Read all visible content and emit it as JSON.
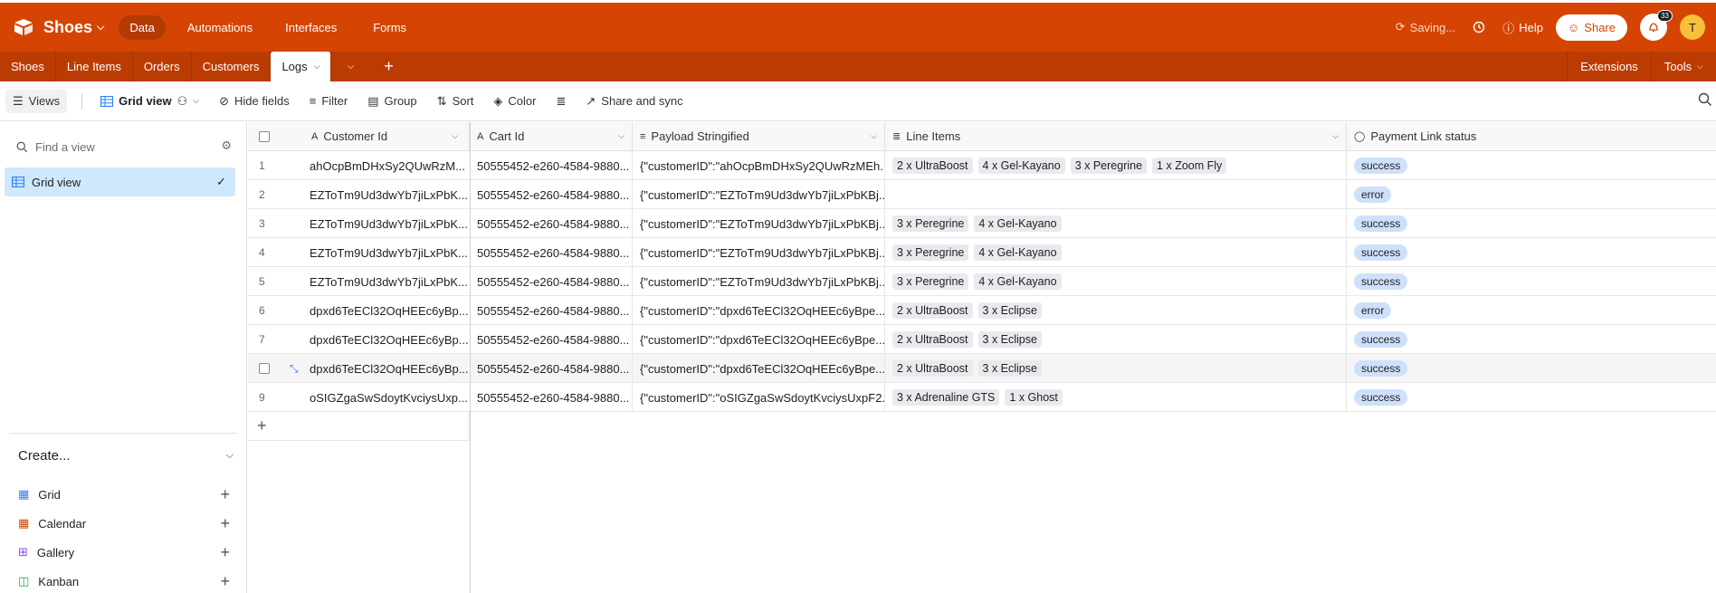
{
  "app": {
    "base_name": "Shoes",
    "nav": [
      "Data",
      "Automations",
      "Interfaces",
      "Forms"
    ],
    "saving_text": "Saving...",
    "help_label": "Help",
    "share_label": "Share",
    "notif_count": "33",
    "avatar_initial": "T",
    "brand_color": "#d54402"
  },
  "tabs": {
    "items": [
      "Shoes",
      "Line Items",
      "Orders",
      "Customers"
    ],
    "active": "Logs",
    "extensions_label": "Extensions",
    "tools_label": "Tools"
  },
  "toolbar": {
    "views": "Views",
    "grid_view": "Grid view",
    "hide_fields": "Hide fields",
    "filter": "Filter",
    "group": "Group",
    "sort": "Sort",
    "color": "Color",
    "share_sync": "Share and sync"
  },
  "sidebar": {
    "find_placeholder": "Find a view",
    "active_view": "Grid view",
    "create_label": "Create...",
    "create_items": [
      "Grid",
      "Calendar",
      "Gallery",
      "Kanban"
    ]
  },
  "grid": {
    "columns": [
      "Customer Id",
      "Cart Id",
      "Payload Stringified",
      "Line Items",
      "Payment Link status"
    ],
    "rows": [
      {
        "num": "1",
        "customer": "ahOcpBmDHxSy2QUwRzM...",
        "cart": "50555452-e260-4584-9880...",
        "payload": "{\"customerID\":\"ahOcpBmDHxSy2QUwRzMEh...",
        "items": [
          "2 x UltraBoost",
          "4 x Gel-Kayano",
          "3 x Peregrine",
          "1 x Zoom Fly"
        ],
        "status": "success"
      },
      {
        "num": "2",
        "customer": "EZToTm9Ud3dwYb7jiLxPbK...",
        "cart": "50555452-e260-4584-9880...",
        "payload": "{\"customerID\":\"EZToTm9Ud3dwYb7jiLxPbKBj...",
        "items": [],
        "status": "error"
      },
      {
        "num": "3",
        "customer": "EZToTm9Ud3dwYb7jiLxPbK...",
        "cart": "50555452-e260-4584-9880...",
        "payload": "{\"customerID\":\"EZToTm9Ud3dwYb7jiLxPbKBj...",
        "items": [
          "3 x Peregrine",
          "4 x Gel-Kayano"
        ],
        "status": "success"
      },
      {
        "num": "4",
        "customer": "EZToTm9Ud3dwYb7jiLxPbK...",
        "cart": "50555452-e260-4584-9880...",
        "payload": "{\"customerID\":\"EZToTm9Ud3dwYb7jiLxPbKBj...",
        "items": [
          "3 x Peregrine",
          "4 x Gel-Kayano"
        ],
        "status": "success"
      },
      {
        "num": "5",
        "customer": "EZToTm9Ud3dwYb7jiLxPbK...",
        "cart": "50555452-e260-4584-9880...",
        "payload": "{\"customerID\":\"EZToTm9Ud3dwYb7jiLxPbKBj...",
        "items": [
          "3 x Peregrine",
          "4 x Gel-Kayano"
        ],
        "status": "success"
      },
      {
        "num": "6",
        "customer": "dpxd6TeECl32OqHEEc6yBp...",
        "cart": "50555452-e260-4584-9880...",
        "payload": "{\"customerID\":\"dpxd6TeECl32OqHEEc6yBpe...",
        "items": [
          "2 x UltraBoost",
          "3 x Eclipse"
        ],
        "status": "error"
      },
      {
        "num": "7",
        "customer": "dpxd6TeECl32OqHEEc6yBp...",
        "cart": "50555452-e260-4584-9880...",
        "payload": "{\"customerID\":\"dpxd6TeECl32OqHEEc6yBpe...",
        "items": [
          "2 x UltraBoost",
          "3 x Eclipse"
        ],
        "status": "success"
      },
      {
        "num": "",
        "customer": "dpxd6TeECl32OqHEEc6yBp...",
        "cart": "50555452-e260-4584-9880...",
        "payload": "{\"customerID\":\"dpxd6TeECl32OqHEEc6yBpe...",
        "items": [
          "2 x UltraBoost",
          "3 x Eclipse"
        ],
        "status": "success"
      },
      {
        "num": "9",
        "customer": "oSIGZgaSwSdoytKvciysUxp...",
        "cart": "50555452-e260-4584-9880...",
        "payload": "{\"customerID\":\"oSIGZgaSwSdoytKvciysUxpF2...",
        "items": [
          "3 x Adrenaline GTS",
          "1 x Ghost"
        ],
        "status": "success"
      }
    ]
  }
}
